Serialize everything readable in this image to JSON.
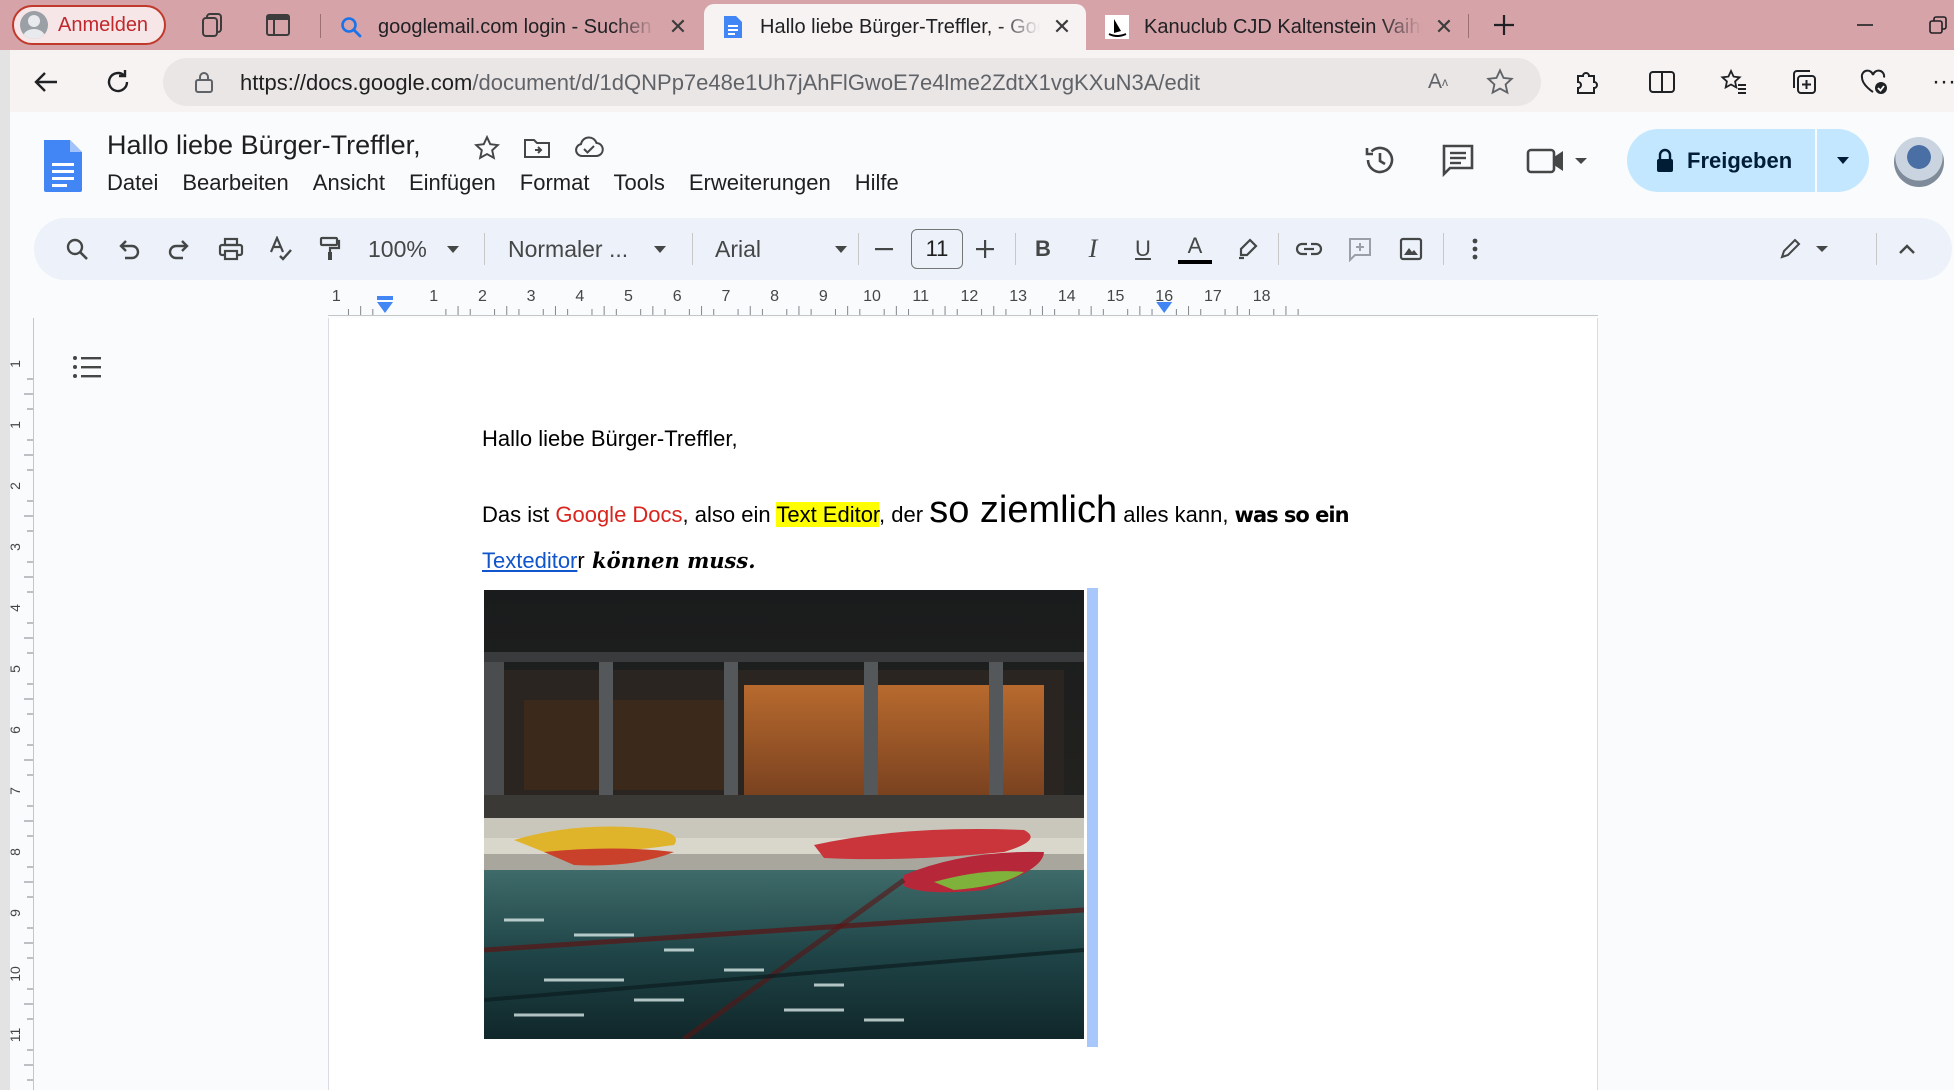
{
  "browser": {
    "profile_label": "Anmelden",
    "tabs": [
      {
        "title": "googlemail.com login - Suchen",
        "icon": "search-icon",
        "active": false
      },
      {
        "title": "Hallo liebe Bürger-Treffler, - Google Docs",
        "icon": "docs-icon",
        "active": true
      },
      {
        "title": "Kanuclub CJD Kaltenstein Vaihingen",
        "icon": "kanu-icon",
        "active": false
      }
    ],
    "url_host": "https://docs.google.com",
    "url_path": "/document/d/1dQNPp7e48e1Uh7jAhFlGwoE7e4lme2ZdtX1vgKXuN3A/edit",
    "read_aloud_label": "A̅"
  },
  "docs": {
    "title": "Hallo liebe Bürger-Treffler,",
    "menu": [
      "Datei",
      "Bearbeiten",
      "Ansicht",
      "Einfügen",
      "Format",
      "Tools",
      "Erweiterungen",
      "Hilfe"
    ],
    "share_label": "Freigeben",
    "toolbar": {
      "zoom": "100%",
      "style": "Normaler ...",
      "font": "Arial",
      "font_size": "11",
      "bold": "B",
      "italic": "I",
      "underline": "U",
      "text_color": "A"
    },
    "ruler_labels": [
      "2",
      "1",
      "1",
      "2",
      "3",
      "4",
      "5",
      "6",
      "7",
      "8",
      "9",
      "10",
      "11",
      "12",
      "13",
      "14",
      "15",
      "16",
      "17",
      "18"
    ],
    "vruler_labels": [
      "1",
      "1",
      "2",
      "3",
      "4",
      "5",
      "6",
      "7",
      "8",
      "9",
      "10",
      "11"
    ]
  },
  "document": {
    "line1": "Hallo liebe Bürger-Treffler,",
    "p2_a": "Das ist ",
    "p2_red": "Google Docs",
    "p2_b": ", also ein ",
    "p2_hl": "Text Editor",
    "p2_c": ", der ",
    "p2_big": "so ziemlich",
    "p2_d": " alles kann, ",
    "p2_bold": "was so ein",
    "p3_link": "Texteditor",
    "p3_r": "r",
    "p3_script": " können muss.",
    "image_alt": "Kajaks im Hallenbad"
  },
  "colors": {
    "tabstrip": "#d6a3a8",
    "red_text": "#d9251d",
    "highlight": "#ffff00",
    "link": "#1155cc",
    "share_bg": "#c2e7ff"
  }
}
